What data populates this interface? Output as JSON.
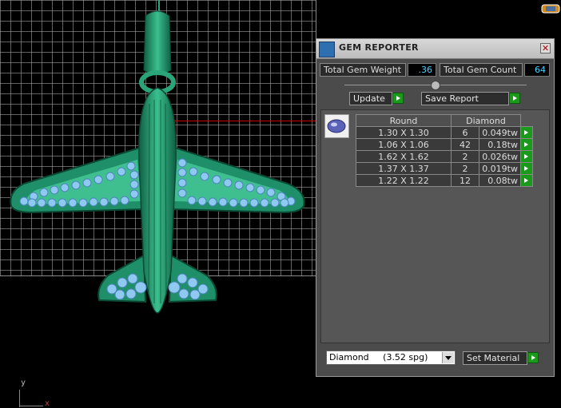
{
  "panel": {
    "title": "GEM REPORTER",
    "total_weight_label": "Total Gem Weight",
    "total_weight_value": ".36",
    "total_count_label": "Total Gem Count",
    "total_count_value": "64",
    "update_label": "Update",
    "save_report_label": "Save Report",
    "table": {
      "headers": [
        "Round",
        "Diamond"
      ],
      "rows": [
        {
          "size": "1.30 X 1.30",
          "count": "6",
          "weight": "0.049tw"
        },
        {
          "size": "1.06 X 1.06",
          "count": "42",
          "weight": "0.18tw"
        },
        {
          "size": "1.62 X 1.62",
          "count": "2",
          "weight": "0.026tw"
        },
        {
          "size": "1.37 X 1.37",
          "count": "2",
          "weight": "0.019tw"
        },
        {
          "size": "1.22 X 1.22",
          "count": "12",
          "weight": "0.08tw"
        }
      ]
    },
    "material_select_value": "Diamond     (3.52 spg)",
    "set_material_label": "Set Material"
  },
  "viewport": {
    "axis_y": "y",
    "axis_x": "x"
  },
  "colors": {
    "model": "#1f8f6a",
    "gems": "#8fc8f0",
    "value_text": "#4fd1ff",
    "green_button": "#1a9a1a",
    "panel_bg": "#4b4b4b"
  },
  "icons": [
    "gem-reporter-icon",
    "close-icon",
    "round-gem-icon",
    "dropdown-arrow-icon",
    "green-arrow-icon"
  ]
}
